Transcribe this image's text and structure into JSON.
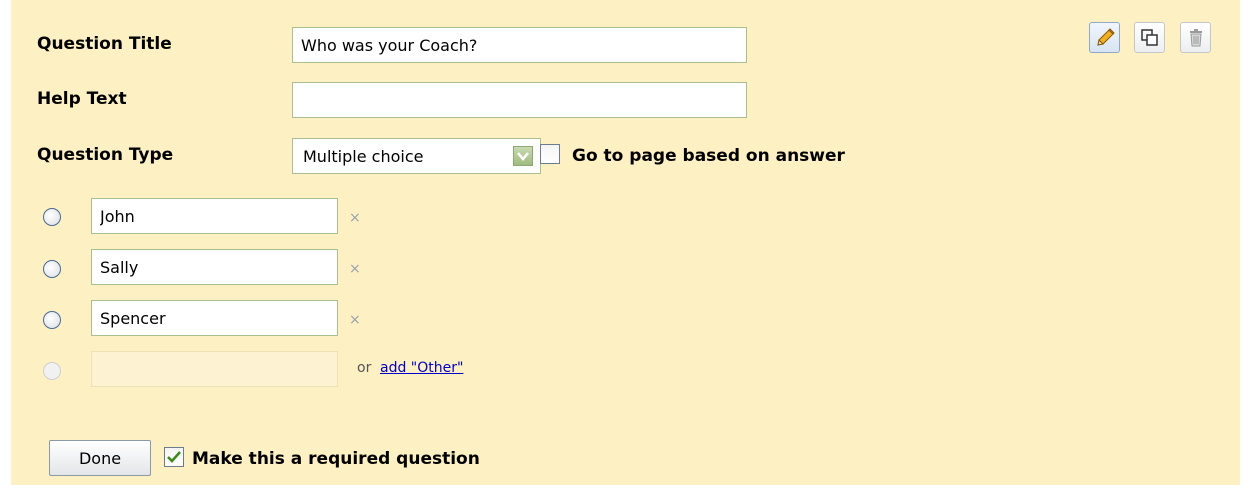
{
  "form": {
    "title_label": "Question Title",
    "title_value": "Who was your Coach?",
    "help_label": "Help Text",
    "help_value": "",
    "type_label": "Question Type",
    "type_value": "Multiple choice",
    "go_to_page_label": "Go to page based on answer",
    "go_to_page_checked": false
  },
  "options": [
    {
      "value": "John",
      "remove": "×"
    },
    {
      "value": "Sally",
      "remove": "×"
    },
    {
      "value": "Spencer",
      "remove": "×"
    }
  ],
  "new_option": {
    "value": "",
    "or_text": "or",
    "add_other_label": "add \"Other\""
  },
  "toolbar": {
    "edit_icon": "pencil-icon",
    "duplicate_icon": "duplicate-icon",
    "delete_icon": "trash-icon"
  },
  "footer": {
    "done_label": "Done",
    "required_label": "Make this a required question",
    "required_checked": true
  },
  "colors": {
    "panel_bg": "#fdf0c2",
    "link": "#0000cc",
    "check": "#3a8c1a",
    "field_border": "#a9bf8e"
  }
}
